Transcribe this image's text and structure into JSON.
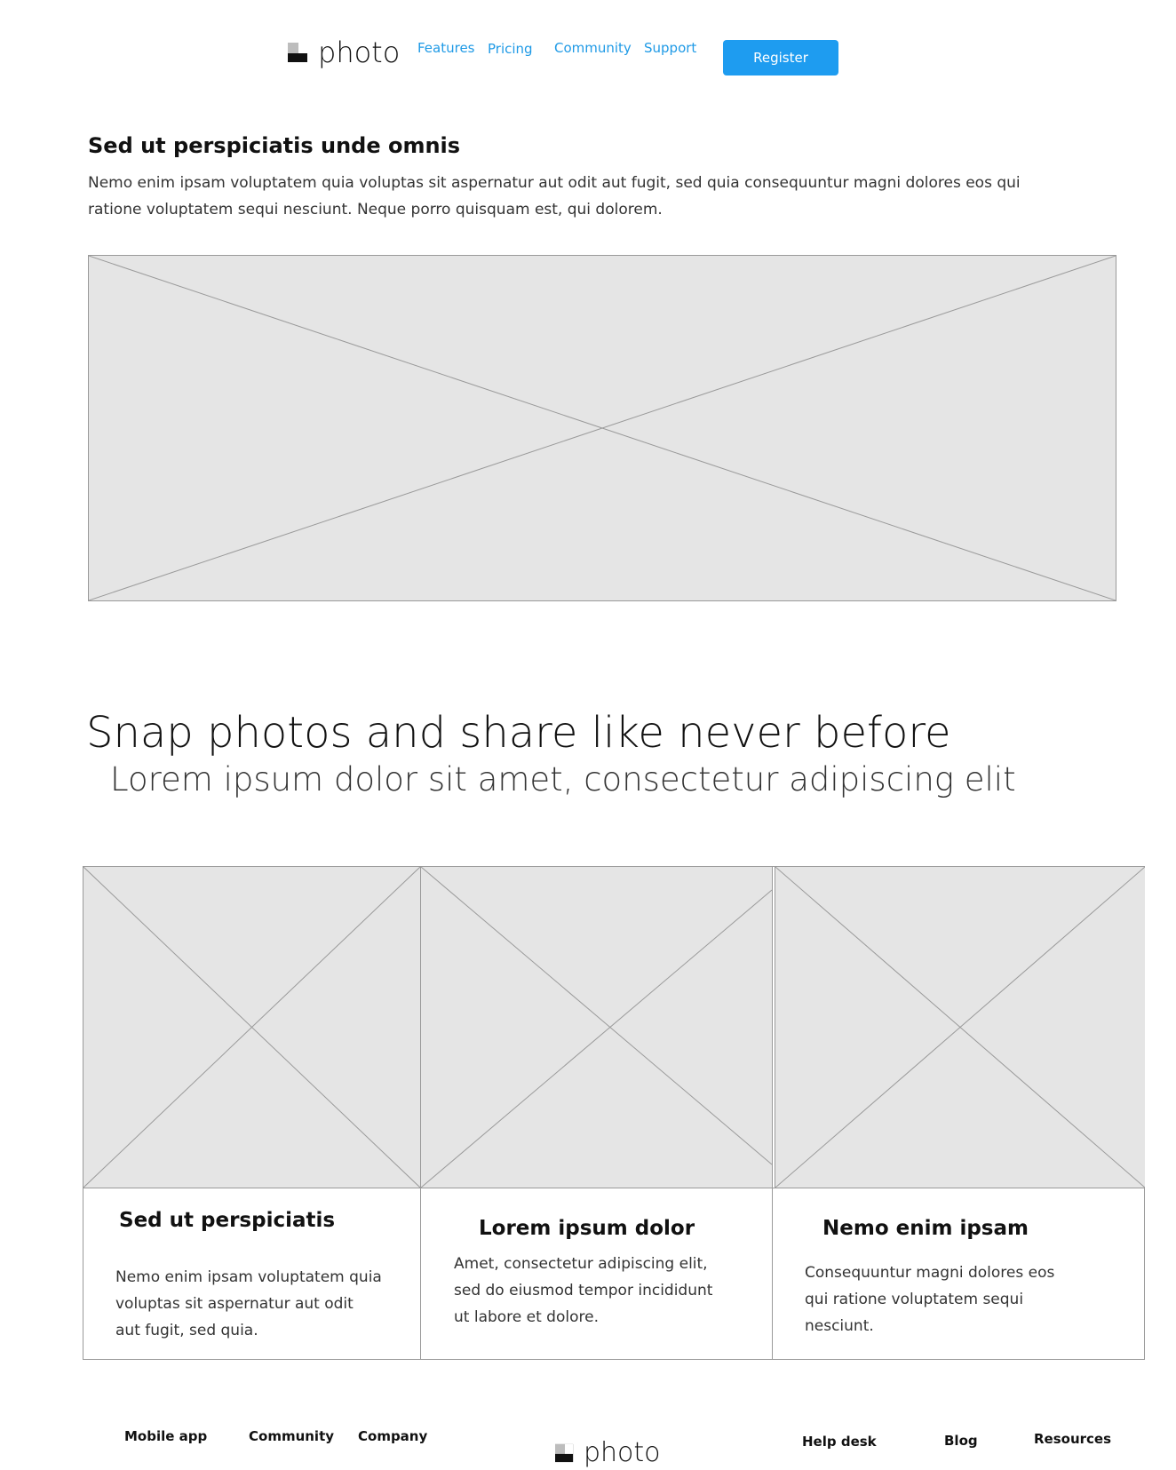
{
  "header": {
    "logo_text": "photo",
    "nav": [
      "Features",
      "Pricing",
      "Community",
      "Support"
    ],
    "register_label": "Register"
  },
  "intro": {
    "title": "Sed ut perspiciatis unde omnis",
    "body": "Nemo enim ipsam voluptatem quia voluptas sit aspernatur aut odit aut fugit, sed quia consequuntur magni dolores eos qui ratione voluptatem sequi nesciunt. Neque porro quisquam est, qui dolorem."
  },
  "hero": {
    "title": "Snap photos and share like never before",
    "subtitle": "Lorem ipsum dolor sit amet, consectetur adipiscing elit"
  },
  "cards": [
    {
      "title": "Sed ut perspiciatis",
      "body": "Nemo enim ipsam voluptatem quia voluptas sit aspernatur aut odit aut fugit, sed quia."
    },
    {
      "title": "Lorem ipsum dolor",
      "body": "Amet, consectetur adipiscing elit, sed do eiusmod tempor incididunt ut labore et dolore."
    },
    {
      "title": "Nemo enim ipsam",
      "body": "Consequuntur magni dolores eos qui ratione voluptatem sequi nesciunt."
    }
  ],
  "footer": {
    "left_links": [
      "Mobile app",
      "Community",
      "Company"
    ],
    "logo_text": "photo",
    "right_links": [
      "Help desk",
      "Blog",
      "Resources"
    ]
  },
  "colors": {
    "accent": "#1e9cf0",
    "link": "#1f9ae6",
    "placeholder_fill": "#e5e5e5",
    "placeholder_stroke": "#9a9a9a"
  },
  "icons": {
    "logo": "photo-logo-icon",
    "image_placeholder": "image-placeholder-icon"
  }
}
